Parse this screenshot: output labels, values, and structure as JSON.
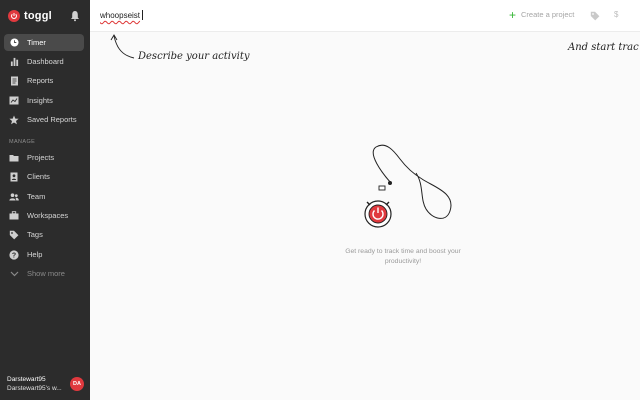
{
  "brand": {
    "name": "toggl",
    "accent": "#e0393e"
  },
  "sidebar": {
    "items": [
      {
        "label": "Timer",
        "icon": "clock-icon",
        "active": true
      },
      {
        "label": "Dashboard",
        "icon": "bar-chart-icon"
      },
      {
        "label": "Reports",
        "icon": "document-icon"
      },
      {
        "label": "Insights",
        "icon": "insights-icon"
      },
      {
        "label": "Saved Reports",
        "icon": "star-icon"
      }
    ],
    "manage_label": "MANAGE",
    "manage_items": [
      {
        "label": "Projects",
        "icon": "folder-icon"
      },
      {
        "label": "Clients",
        "icon": "contact-icon"
      },
      {
        "label": "Team",
        "icon": "team-icon"
      },
      {
        "label": "Workspaces",
        "icon": "briefcase-icon"
      },
      {
        "label": "Tags",
        "icon": "tag-icon"
      },
      {
        "label": "Help",
        "icon": "help-icon"
      },
      {
        "label": "Show more",
        "icon": "chevron-down-icon"
      }
    ],
    "user": {
      "name": "Darstewart95",
      "workspace": "Darstewart95's w...",
      "initials": "DA"
    }
  },
  "topbar": {
    "description_value": "whoopseist",
    "create_project_label": "Create a project"
  },
  "main": {
    "hint_describe": "Describe your activity",
    "hint_start": "And start trac",
    "empty_line1": "Get ready to track time and boost your",
    "empty_line2": "productivity!"
  }
}
